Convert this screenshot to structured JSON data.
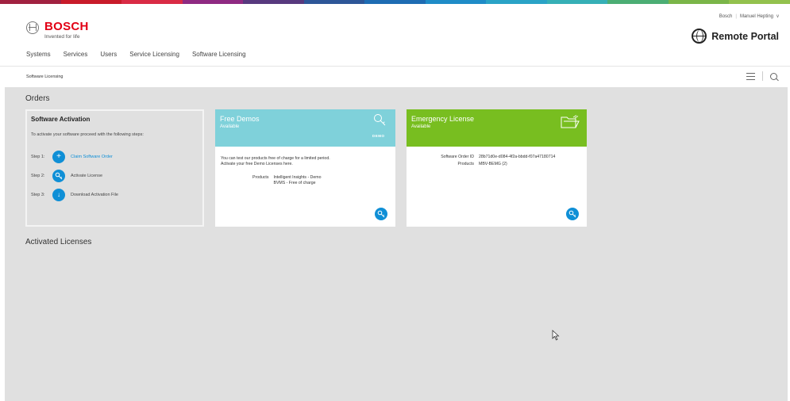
{
  "supergraphic_colors": [
    "#a12140",
    "#c81b2a",
    "#d92b45",
    "#8f2a82",
    "#58397e",
    "#2d5698",
    "#1e6cb3",
    "#1f8cc7",
    "#2aa3c6",
    "#36b0b6",
    "#4bae74",
    "#7ab548",
    "#93c14d"
  ],
  "brand": {
    "name": "BOSCH",
    "tagline": "Invented for life"
  },
  "user_menu": {
    "company": "Bosch",
    "user": "Manuel Hepting",
    "chevron": "v"
  },
  "portal": {
    "title": "Remote Portal"
  },
  "nav": {
    "items": [
      {
        "label": "Systems"
      },
      {
        "label": "Services"
      },
      {
        "label": "Users"
      },
      {
        "label": "Service Licensing"
      },
      {
        "label": "Software Licensing"
      }
    ],
    "active_index": 4
  },
  "breadcrumb": {
    "text": "Software Licensing"
  },
  "orders": {
    "title": "Orders"
  },
  "activation": {
    "title": "Software Activation",
    "description": "To activate your software proceed with the following steps:",
    "steps": [
      {
        "label": "Step 1:",
        "text": "Claim Software Order",
        "icon": "plus-icon",
        "glyph": "+"
      },
      {
        "label": "Step 2:",
        "text": "Activate License",
        "icon": "key-icon"
      },
      {
        "label": "Step 3:",
        "text": "Download Activation File",
        "icon": "download-icon",
        "glyph": "↓"
      }
    ]
  },
  "free_demos": {
    "title": "Free Demos",
    "status": "Available",
    "badge": "DEMO",
    "color": "#7fd1da",
    "text_line1": "You can test our products free of charge for a limited period.",
    "text_line2": "Activate your free Demo Licenses here.",
    "products_label": "Products",
    "products": [
      "Intelligent Insights - Demo",
      "BVMS - Free of charge"
    ]
  },
  "emergency": {
    "title": "Emergency License",
    "status": "Available",
    "color": "#78be20",
    "order_id_label": "Software Order ID",
    "order_id": "28b71d0e-d084-4f2a-bbdd-f07a47180714",
    "products_label": "Products",
    "products": "MBV-BEMG (2)"
  },
  "activated": {
    "title": "Activated Licenses"
  },
  "accent_color": "#0f8fd6"
}
